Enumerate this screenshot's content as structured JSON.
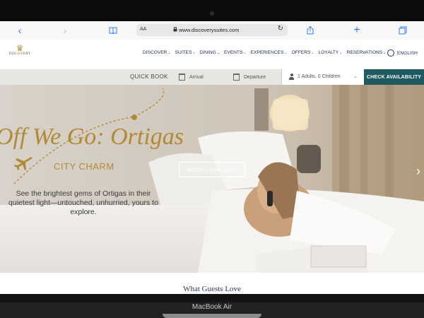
{
  "browser": {
    "url": "www.discoverysuites.com",
    "reader_label": "AA",
    "icons": [
      "back-icon",
      "forward-icon",
      "bookmarks-icon",
      "lock-icon",
      "reload-icon",
      "share-icon",
      "new-tab-icon",
      "tabs-icon"
    ]
  },
  "header": {
    "logo_text": "DISCOVERY",
    "nav": [
      "DISCOVER",
      "SUITES",
      "DINING",
      "EVENTS",
      "EXPERIENCES",
      "OFFERS",
      "LOYALTY",
      "RESERVATIONS"
    ],
    "language": "ENGLISH"
  },
  "booking": {
    "label": "QUICK BOOK",
    "arrival": "Arrival",
    "departure": "Departure",
    "guests": "1 Adults, 0 Children",
    "cta": "CHECK AVAILABILITY"
  },
  "hero": {
    "title": "Off We Go: Ortigas",
    "subtitle": "CITY CHARM",
    "description": "See the brightest gems of Ortigas in their quietest light—untouched, unhurried, yours to explore.",
    "cta": "BOOK YOUR STAY"
  },
  "section": {
    "title": "What Guests Love"
  },
  "device": {
    "label": "MacBook Air"
  },
  "colors": {
    "accent_teal": "#1e5a60",
    "gold": "#b08a35",
    "navy": "#25305a"
  }
}
